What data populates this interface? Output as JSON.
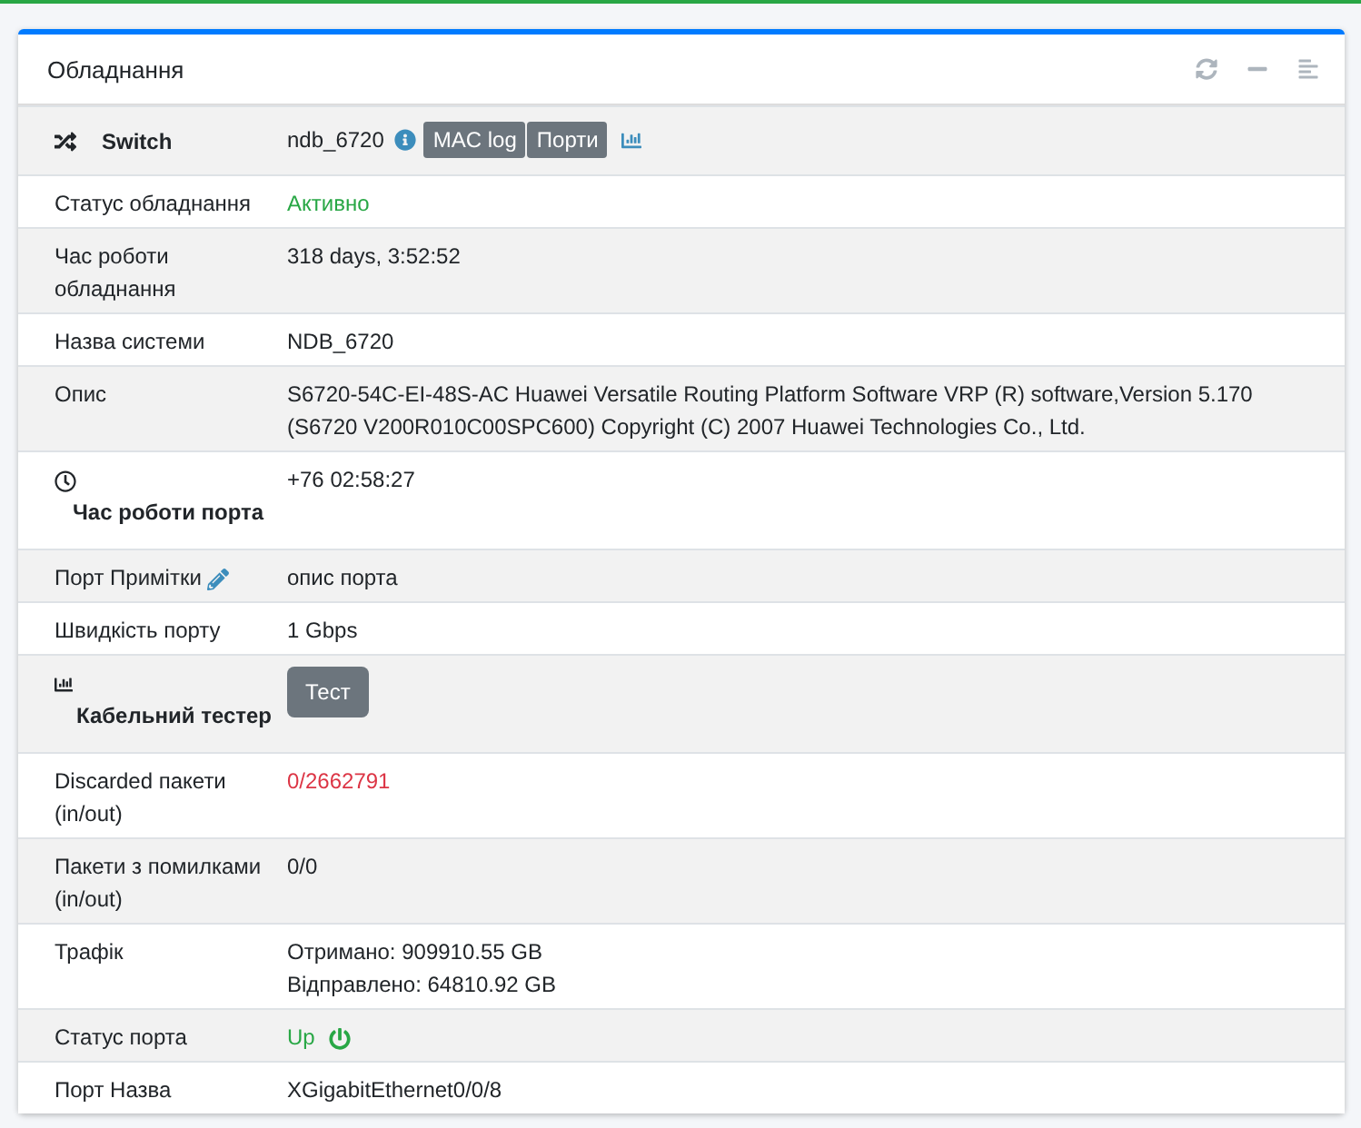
{
  "card": {
    "title": "Обладнання"
  },
  "rows": [
    {
      "kind": "device",
      "label": "Switch",
      "value": "ndb_6720",
      "buttons": [
        "MAC log",
        "Порти"
      ]
    },
    {
      "kind": "text",
      "label": "Статус обладнання",
      "value": "Активно",
      "color": "#28a745"
    },
    {
      "kind": "text",
      "label": "Час роботи обладнання",
      "value": "318 days, 3:52:52"
    },
    {
      "kind": "text",
      "label": "Назва системи",
      "value": "NDB_6720"
    },
    {
      "kind": "text",
      "label": "Опис",
      "value": "S6720-54C-EI-48S-AC Huawei Versatile Routing Platform Software VRP (R) software,Version 5.170 (S6720 V200R010C00SPC600) Copyright (C) 2007 Huawei Technologies Co., Ltd."
    },
    {
      "kind": "uptime",
      "label": "Час роботи порта",
      "value": "+76 02:58:27"
    },
    {
      "kind": "editable",
      "label": "Порт Примітки",
      "value": "опис порта"
    },
    {
      "kind": "text",
      "label": "Швидкість порту",
      "value": "1 Gbps"
    },
    {
      "kind": "tester",
      "label": "Кабельний тестер",
      "button": "Тест"
    },
    {
      "kind": "text",
      "label": "Discarded пакети (in/out)",
      "value": "0/2662791",
      "color": "#dc3545"
    },
    {
      "kind": "text",
      "label": "Пакети з помилками (in/out)",
      "value": "0/0"
    },
    {
      "kind": "lines",
      "label": "Трафік",
      "lines": [
        "Отримано: 909910.55 GB",
        "Відправлено: 64810.92 GB"
      ]
    },
    {
      "kind": "power",
      "label": "Статус порта",
      "value": "Up",
      "on": true
    },
    {
      "kind": "text",
      "label": "Порт Назва",
      "value": "XGigabitEthernet0/0/8"
    }
  ]
}
